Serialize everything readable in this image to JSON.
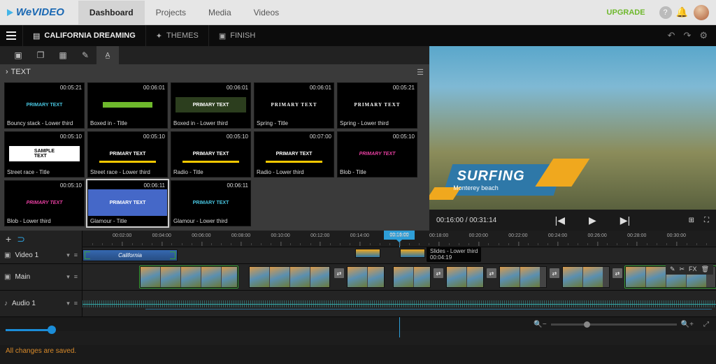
{
  "brand": "WeVIDEO",
  "nav": {
    "dashboard": "Dashboard",
    "projects": "Projects",
    "media": "Media",
    "videos": "Videos"
  },
  "upgrade": "UPGRADE",
  "project": {
    "title": "CALIFORNIA DREAMING",
    "themes": "THEMES",
    "finish": "FINISH"
  },
  "media_header": "TEXT",
  "thumbs": [
    {
      "dur": "00:05:21",
      "label": "Bouncy stack - Lower third",
      "style": "teal"
    },
    {
      "dur": "00:06:01",
      "label": "Boxed in - Title",
      "style": "greenbar"
    },
    {
      "dur": "00:06:01",
      "label": "Boxed in - Lower third",
      "style": "greenband"
    },
    {
      "dur": "00:06:01",
      "label": "Spring - Title",
      "style": "minimal"
    },
    {
      "dur": "00:05:21",
      "label": "Spring - Lower third",
      "style": "minimal"
    },
    {
      "dur": "00:05:10",
      "label": "Street race - Title",
      "style": "sample"
    },
    {
      "dur": "00:05:10",
      "label": "Street race - Lower third",
      "style": "yellow"
    },
    {
      "dur": "00:05:10",
      "label": "Radio - Title",
      "style": "yellow"
    },
    {
      "dur": "00:07:00",
      "label": "Radio - Lower third",
      "style": "yellow"
    },
    {
      "dur": "00:05:10",
      "label": "Blob - Title",
      "style": "pink"
    },
    {
      "dur": "00:05:10",
      "label": "Blob - Lower third",
      "style": "pink"
    },
    {
      "dur": "00:06:11",
      "label": "Glamour - Title",
      "style": "blue",
      "selected": true
    },
    {
      "dur": "00:06:11",
      "label": "Glamour - Lower third",
      "style": "teal"
    }
  ],
  "preview": {
    "title": "SURFING",
    "subtitle": "Monterey beach",
    "current": "00:16:00",
    "total": "00:31:14"
  },
  "timeline": {
    "add": "+",
    "playhead": "00:16:00",
    "ticks": [
      "00:02:00",
      "00:04:00",
      "00:06:00",
      "00:08:00",
      "00:10:00",
      "00:12:00",
      "00:14:00",
      "00:16:00",
      "00:18:00",
      "00:20:00",
      "00:22:00",
      "00:24:00",
      "00:26:00",
      "00:28:00",
      "00:30:00"
    ],
    "tracks": {
      "video": "Video 1",
      "main": "Main",
      "audio": "Audio 1"
    },
    "video1_clip": "California",
    "tooltip_title": "Slides - Lower third",
    "tooltip_dur": "00:04:19",
    "fx": "FX"
  },
  "status": "All changes are saved."
}
